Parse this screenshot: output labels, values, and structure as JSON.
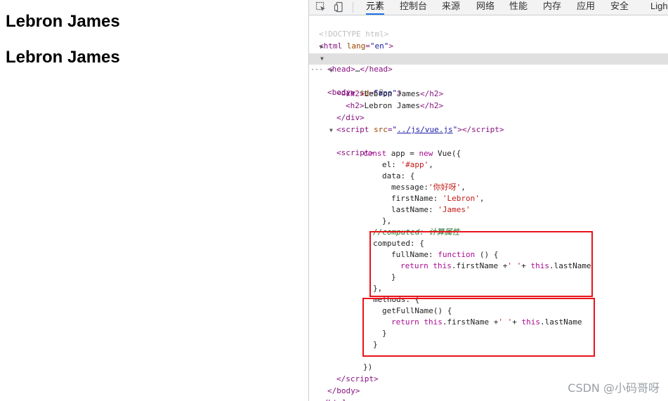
{
  "page": {
    "headings": [
      "Lebron James",
      "Lebron James"
    ]
  },
  "devtools": {
    "tabs": [
      {
        "label": "元素",
        "active": true
      },
      {
        "label": "控制台"
      },
      {
        "label": "来源"
      },
      {
        "label": "网络"
      },
      {
        "label": "性能"
      },
      {
        "label": "内存"
      },
      {
        "label": "应用"
      },
      {
        "label": "安全"
      },
      {
        "label": "Light"
      }
    ],
    "icons": {
      "inspect": "inspect-icon",
      "device": "device-toggle-icon"
    },
    "code": {
      "doctype": "<!DOCTYPE html>",
      "html_open": "html",
      "lang_attr": "lang",
      "lang_val": "\"en\"",
      "head_collapsed": "head",
      "ellipsis": "…",
      "body_tag": "body",
      "body_ref": "== $0",
      "div_tag": "div",
      "id_attr": "id",
      "id_val": "\"app\"",
      "h2_tag": "h2",
      "h2_text": "Lebron James",
      "script_tag": "script",
      "src_attr": "src",
      "src_val": "../js/vue.js",
      "js_lines": [
        "const app = new Vue({",
        "el: '#app',",
        "data: {",
        "message:'你好呀',",
        "firstName: 'Lebron',",
        "lastName: 'James'",
        "},",
        "//computed: 计算属性",
        "computed: {",
        "fullName: function () {",
        "return this.firstName +' '+ this.lastName",
        "}",
        "},",
        "methods: {",
        "getFullName() {",
        "return this.firstName +' '+ this.lastName",
        "}",
        "}",
        "})"
      ]
    },
    "accent_color": "#1a73e8",
    "highlight_color": "#e8141b"
  },
  "watermark": "CSDN @小码哥呀"
}
